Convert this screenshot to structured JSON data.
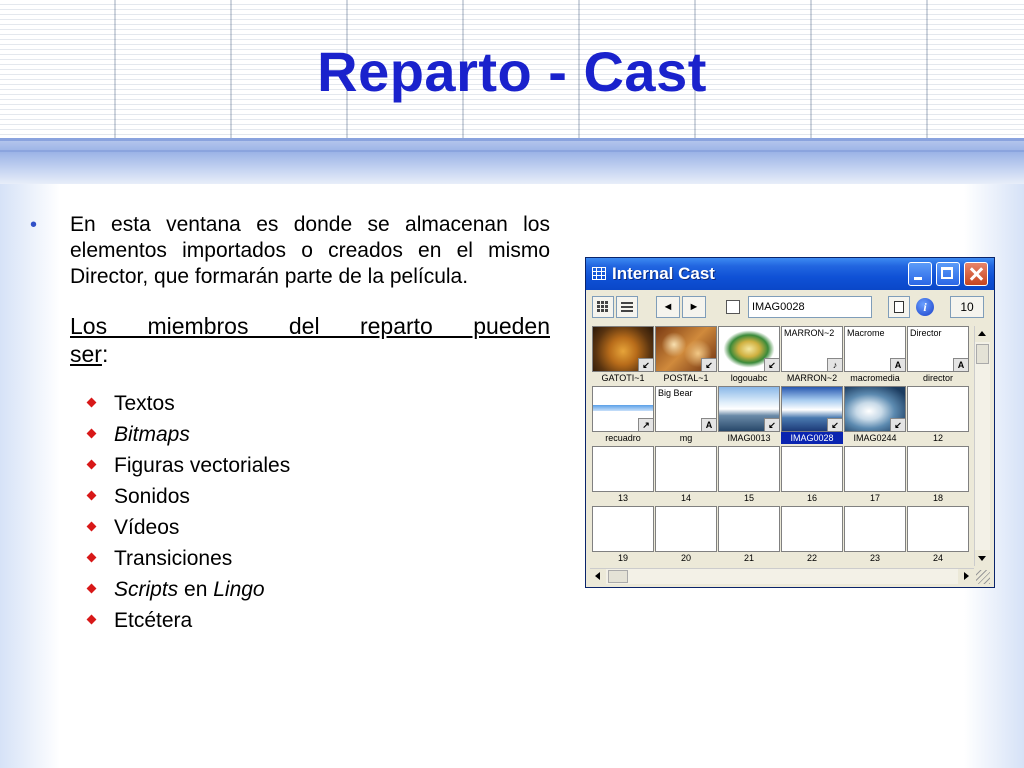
{
  "slide": {
    "title": "Reparto - Cast",
    "paragraph": "En esta ventana es donde se almacenan los elementos importados o creados en el mismo Director, que formarán parte de la película.",
    "subhead_line1": "Los miembros del reparto pueden",
    "subhead_line2_u": "ser",
    "subhead_line2_colon": ":",
    "items": [
      {
        "text": "Textos"
      },
      {
        "text": "Bitmaps"
      },
      {
        "text": "Figuras vectoriales"
      },
      {
        "text": "Sonidos"
      },
      {
        "text": "Vídeos"
      },
      {
        "text": "Transiciones"
      },
      {
        "text_a": "Scripts",
        "text_b": " en ",
        "text_c": "Lingo"
      },
      {
        "text": "Etcétera"
      }
    ]
  },
  "cast_window": {
    "title": "Internal Cast",
    "prev_label": "◄",
    "next_label": "►",
    "member_name": "IMAG0028",
    "info_label": "i",
    "cast_number": "10",
    "members": [
      {
        "label": "GATOTI~1",
        "badge": "↙"
      },
      {
        "label": "POSTAL~1",
        "badge": "↙"
      },
      {
        "label": "logouabc",
        "badge": "↙"
      },
      {
        "label": "MARRON~2",
        "thumb_text": "MARRON~2",
        "badge": "♪"
      },
      {
        "label": "macromedia",
        "thumb_text": "Macrome",
        "badge": "A"
      },
      {
        "label": "director",
        "thumb_text": "Director",
        "badge": "A"
      },
      {
        "label": "recuadro",
        "badge": "↗"
      },
      {
        "label": "mg",
        "thumb_text": "Big Bear",
        "badge": "A"
      },
      {
        "label": "IMAG0013",
        "badge": "↙"
      },
      {
        "label": "IMAG0028",
        "badge": "↙"
      },
      {
        "label": "IMAG0244",
        "badge": "↙"
      },
      {
        "label": "12"
      },
      {
        "label": "13"
      },
      {
        "label": "14"
      },
      {
        "label": "15"
      },
      {
        "label": "16"
      },
      {
        "label": "17"
      },
      {
        "label": "18"
      },
      {
        "label": "19"
      },
      {
        "label": "20"
      },
      {
        "label": "21"
      },
      {
        "label": "22"
      },
      {
        "label": "23"
      },
      {
        "label": "24"
      }
    ]
  },
  "colors": {
    "title_blue": "#1a22cc",
    "bullet_red": "#d81818",
    "titlebar_blue": "#0f51d6",
    "selection_blue": "#0a24b0"
  },
  "icons": {
    "bullet": "•"
  }
}
